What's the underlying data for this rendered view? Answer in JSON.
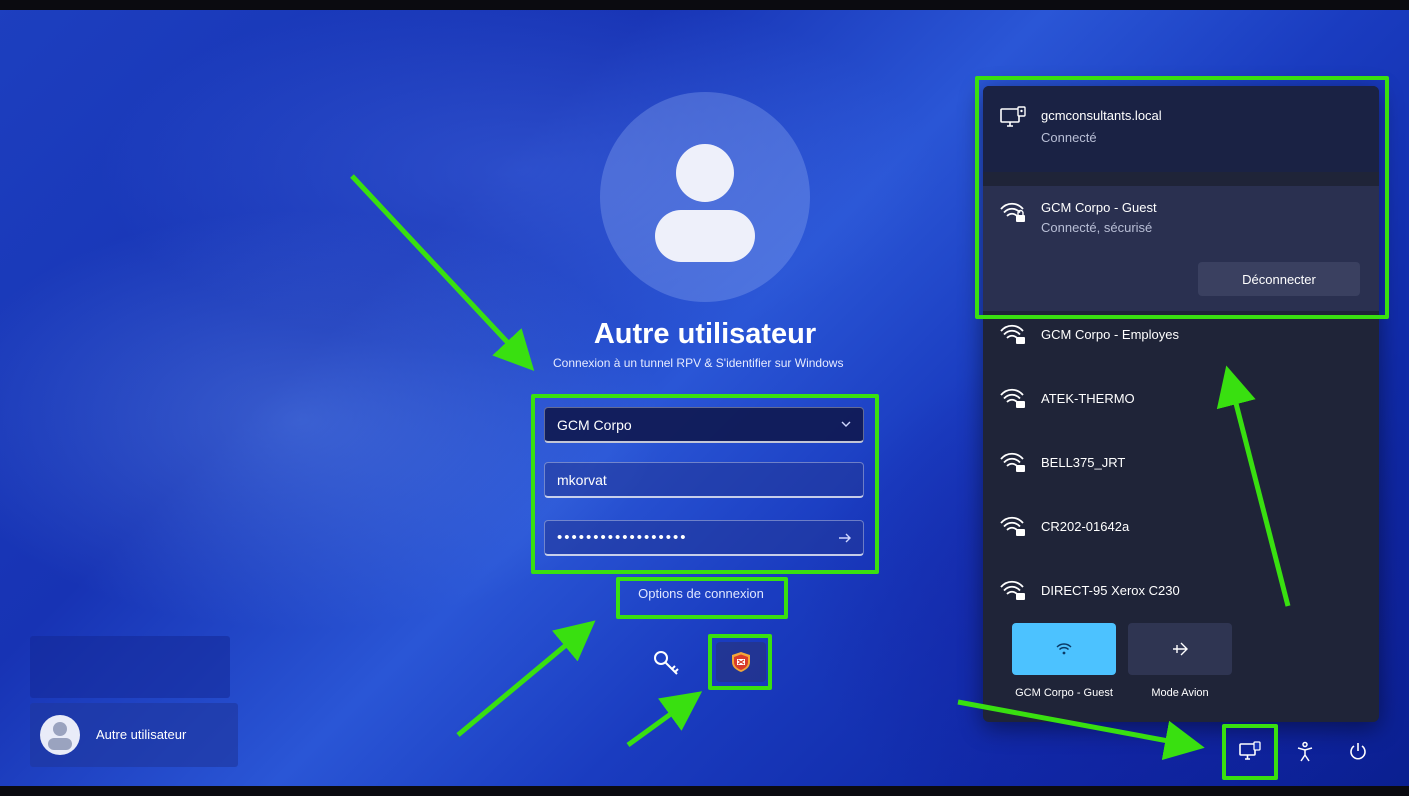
{
  "login": {
    "user_title": "Autre utilisateur",
    "vpn_subtitle": "Connexion à un tunnel RPV & S'identifier sur Windows",
    "vpn_select_value": "GCM Corpo",
    "username_value": "mkorvat",
    "password_mask": "••••••••••••••••••",
    "options_link": "Options de connexion"
  },
  "user_switcher": {
    "user_name": "Autre utilisateur"
  },
  "network_flyout": {
    "domain": {
      "name": "gcmconsultants.local",
      "status": "Connecté"
    },
    "active_wifi": {
      "name": "GCM Corpo - Guest",
      "status": "Connecté, sécurisé",
      "disconnect_label": "Déconnecter"
    },
    "networks": [
      {
        "name": "GCM Corpo - Employes"
      },
      {
        "name": "ATEK-THERMO"
      },
      {
        "name": "BELL375_JRT"
      },
      {
        "name": "CR202-01642a"
      },
      {
        "name": "DIRECT-95 Xerox C230"
      }
    ],
    "quick_settings": {
      "wifi_label": "GCM Corpo - Guest",
      "airplane_label": "Mode Avion"
    }
  },
  "icons": {
    "avatar": "person-icon",
    "key": "key-icon",
    "shield": "shield-icon",
    "network": "network-computer-icon",
    "wifi": "wifi-lock-icon",
    "airplane": "airplane-icon",
    "accessibility": "accessibility-icon",
    "power": "power-icon"
  },
  "colors": {
    "highlight": "#39e010",
    "accent": "#4cc2ff",
    "flyout_bg": "#1f2438"
  }
}
